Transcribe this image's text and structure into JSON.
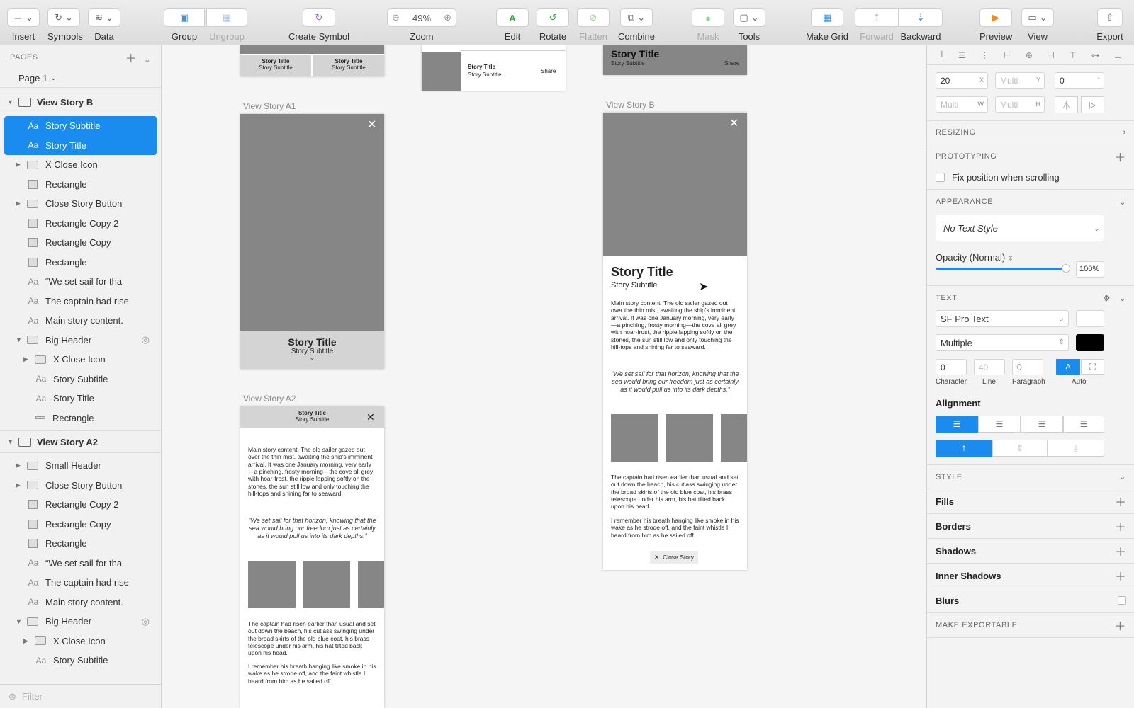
{
  "toolbar": {
    "insert": "Insert",
    "symbols": "Symbols",
    "data": "Data",
    "group": "Group",
    "ungroup": "Ungroup",
    "create_symbol": "Create Symbol",
    "zoom": "Zoom",
    "zoom_value": "49%",
    "edit": "Edit",
    "rotate": "Rotate",
    "flatten": "Flatten",
    "combine": "Combine",
    "mask": "Mask",
    "tools": "Tools",
    "make_grid": "Make Grid",
    "forward": "Forward",
    "backward": "Backward",
    "preview": "Preview",
    "view": "View",
    "export": "Export"
  },
  "sidebar": {
    "pages_header": "PAGES",
    "current_page": "Page 1",
    "filter_placeholder": "Filter",
    "group_b": {
      "title": "View Story B",
      "items": [
        "Story Subtitle",
        "Story Title",
        "X Close Icon",
        "Rectangle",
        "Close Story Button",
        "Rectangle Copy 2",
        "Rectangle Copy",
        "Rectangle",
        "“We set sail for tha",
        "The captain had rise",
        "Main story content.",
        "Big Header",
        "X Close Icon",
        "Story Subtitle",
        "Story Title",
        "Rectangle"
      ]
    },
    "group_a2": {
      "title": "View Story A2",
      "items": [
        "Small Header",
        "Close Story Button",
        "Rectangle Copy 2",
        "Rectangle Copy",
        "Rectangle",
        "“We set sail for tha",
        "The captain had rise",
        "Main story content.",
        "Big Header",
        "X Close Icon",
        "Story Subtitle"
      ]
    }
  },
  "canvas": {
    "story_title": "Story Title",
    "story_subtitle": "Story Subtitle",
    "share": "Share",
    "label_a1": "View Story A1",
    "label_a2": "View Story A2",
    "label_b": "View Story B",
    "body1": "Main story content. The old sailer gazed out over the thin mist, awaiting the ship's imminent arrival. It was one January morning, very early—a pinching, frosty morning—the cove all grey with hoar-frost, the ripple lapping softly on the stones, the sun still low and only touching the hill-tops and shining far to seaward.",
    "quote": "“We set sail for that horizon,  knowing that the sea would bring our freedom just as certainly as it would pull us into its dark depths.”",
    "body2": "The captain had risen earlier than usual and set out down the beach, his cutlass swinging under the broad skirts of the old blue coat, his brass telescope under his arm, his hat tilted back upon his head.",
    "body3": "I remember his breath hanging like smoke in his wake as he strode off, and the faint whistle I heard from him as he sailed off.",
    "close_story": "Close Story"
  },
  "inspector": {
    "x": "20",
    "y": "Multi",
    "rot": "0",
    "w": "Multi",
    "h": "Multi",
    "resizing": "RESIZING",
    "prototyping": "PROTOTYPING",
    "fix_position": "Fix position when scrolling",
    "appearance": "APPEARANCE",
    "text_style": "No Text Style",
    "opacity_label": "Opacity (Normal)",
    "opacity_value": "100%",
    "opacity_fraction": 1.0,
    "text": "TEXT",
    "font": "SF Pro Text",
    "weight": "Multiple",
    "character": "0",
    "line": "40",
    "paragraph": "0",
    "character_label": "Character",
    "line_label": "Line",
    "paragraph_label": "Paragraph",
    "auto_label": "Auto",
    "alignment": "Alignment",
    "style": "STYLE",
    "fills": "Fills",
    "borders": "Borders",
    "shadows": "Shadows",
    "inner_shadows": "Inner Shadows",
    "blurs": "Blurs",
    "make_exportable": "MAKE EXPORTABLE",
    "color_selected": "#1a8cf0",
    "text_color": "#000000"
  }
}
